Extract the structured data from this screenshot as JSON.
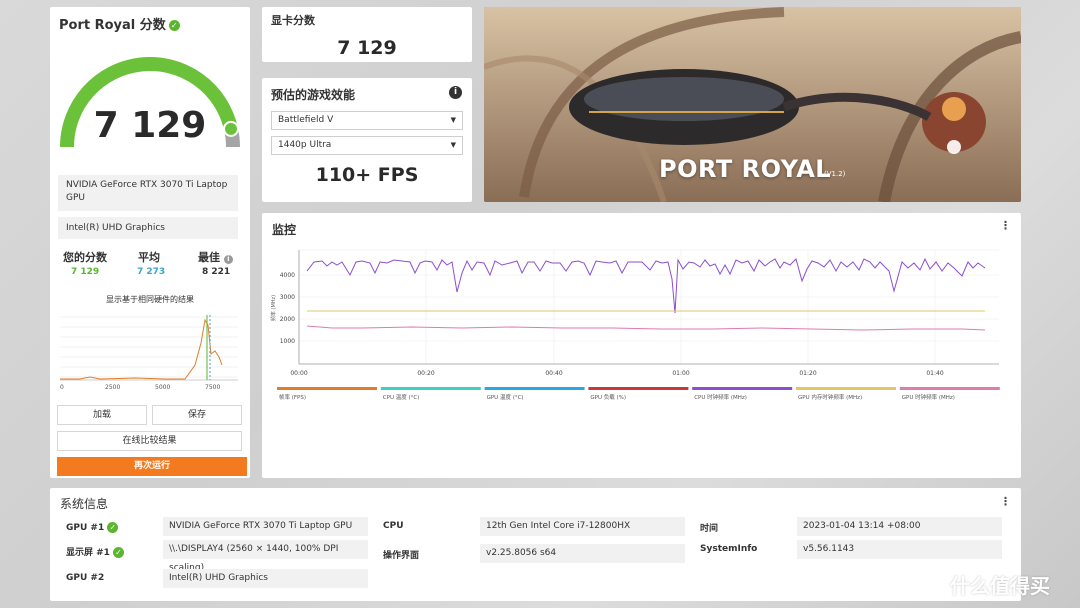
{
  "score_card": {
    "title": "Port Royal 分数",
    "score": "7 129",
    "gauge_fraction": 0.93,
    "hardware": [
      "NVIDIA GeForce RTX 3070 Ti Laptop GPU",
      "Intel(R) UHD Graphics"
    ],
    "stats": [
      {
        "label": "您的分数",
        "value": "7 129",
        "color": "#5ab52f"
      },
      {
        "label": "平均",
        "value": "7 273",
        "color": "#3aa6c9"
      },
      {
        "label": "最佳",
        "value": "8 221",
        "color": "#333333"
      }
    ],
    "dist_caption": "显示基于相同硬件的结果",
    "dist_ticks": [
      "0",
      "2500",
      "5000",
      "7500"
    ],
    "buttons": {
      "load": "加载",
      "save": "保存",
      "compare": "在线比较结果",
      "run": "再次运行"
    }
  },
  "gpu_score": {
    "title": "显卡分数",
    "value": "7 129"
  },
  "perf": {
    "title": "预估的游戏效能",
    "game": "Battlefield V",
    "preset": "1440p Ultra",
    "fps": "110+ FPS"
  },
  "hero": {
    "title": "PORT ROYAL",
    "version": "(V1.2)"
  },
  "monitor": {
    "title": "监控",
    "y_ticks": [
      "4000",
      "3000",
      "2000",
      "1000"
    ],
    "y_axis_label": "频率 (MHz)",
    "x_ticks": [
      "00:00",
      "00:20",
      "00:40",
      "01:00",
      "01:20",
      "01:40"
    ],
    "legend": [
      {
        "label": "帧率 (FPS)",
        "color": "#e07d28"
      },
      {
        "label": "CPU 温度 (°C)",
        "color": "#3fd1c0"
      },
      {
        "label": "GPU 温度 (°C)",
        "color": "#2aa8e0"
      },
      {
        "label": "GPU 负载 (%)",
        "color": "#c83838"
      },
      {
        "label": "CPU 时钟频率 (MHz)",
        "color": "#8b4fcf"
      },
      {
        "label": "GPU 内存时钟频率 (MHz)",
        "color": "#e3c466"
      },
      {
        "label": "GPU 时钟频率 (MHz)",
        "color": "#e07aaf"
      }
    ]
  },
  "sysinfo": {
    "title": "系统信息",
    "rows": [
      {
        "label": "GPU #1",
        "value": "NVIDIA GeForce RTX 3070 Ti Laptop GPU",
        "check": true
      },
      {
        "label": "显示屏 #1",
        "value": "\\\\.\\DISPLAY4 (2560 × 1440, 100% DPI scaling)",
        "check": true
      },
      {
        "label": "GPU #2",
        "value": "Intel(R) UHD Graphics",
        "check": false
      },
      {
        "label": "CPU",
        "value": "12th Gen Intel Core i7-12800HX"
      },
      {
        "label": "操作界面",
        "value": "v2.25.8056 s64"
      },
      {
        "label": "时间",
        "value": "2023-01-04 13:14 +08:00"
      },
      {
        "label": "SystemInfo",
        "value": "v5.56.1143"
      }
    ]
  },
  "watermark": "什么值得买"
}
